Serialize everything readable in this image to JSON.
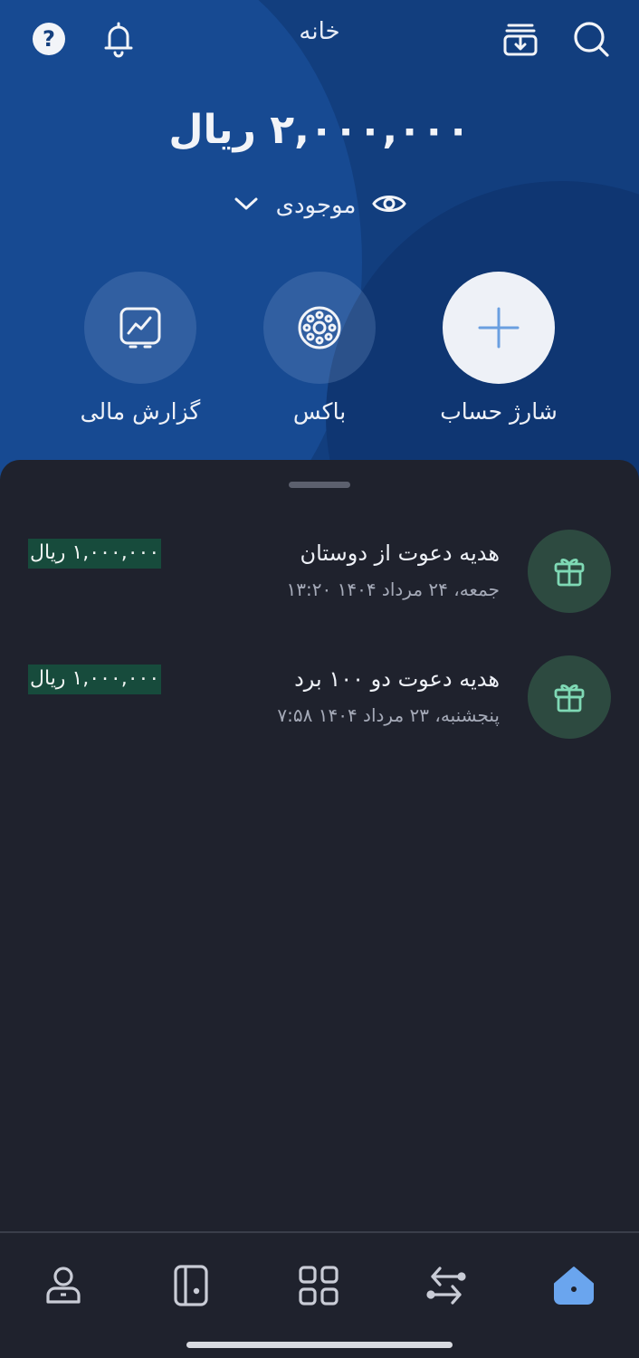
{
  "header": {
    "title": "خانه",
    "icons": [
      "help-icon",
      "bell-icon",
      "download-receipt-icon",
      "search-icon"
    ]
  },
  "balance": {
    "amount_text": "۲,۰۰۰,۰۰۰ ریال",
    "label": "موجودی"
  },
  "actions": [
    {
      "label": "شارژ حساب",
      "icon": "plus-icon"
    },
    {
      "label": "باکس",
      "icon": "box-icon"
    },
    {
      "label": "گزارش مالی",
      "icon": "chart-icon"
    }
  ],
  "transactions": [
    {
      "title": "هدیه دعوت از دوستان",
      "date": "جمعه، ۲۴ مرداد ۱۴۰۴ ۱۳:۲۰",
      "amount": "۱,۰۰۰,۰۰۰ ریال",
      "icon": "gift-icon"
    },
    {
      "title": "هدیه دعوت دو ۱۰۰ برد",
      "date": "پنجشنبه، ۲۳ مرداد ۱۴۰۴ ۷:۵۸",
      "amount": "۱,۰۰۰,۰۰۰ ریال",
      "icon": "gift-icon"
    }
  ],
  "bottom_nav": {
    "items": [
      "profile-icon",
      "card-icon",
      "apps-icon",
      "transfer-icon",
      "home-icon"
    ],
    "active": "home-icon"
  },
  "colors": {
    "hero_bg": "#123e7e",
    "sheet_bg": "#1f222d",
    "amount_bg": "#174b3c",
    "gift_accent": "#7fd9b5",
    "active_nav": "#6aa5ee"
  }
}
